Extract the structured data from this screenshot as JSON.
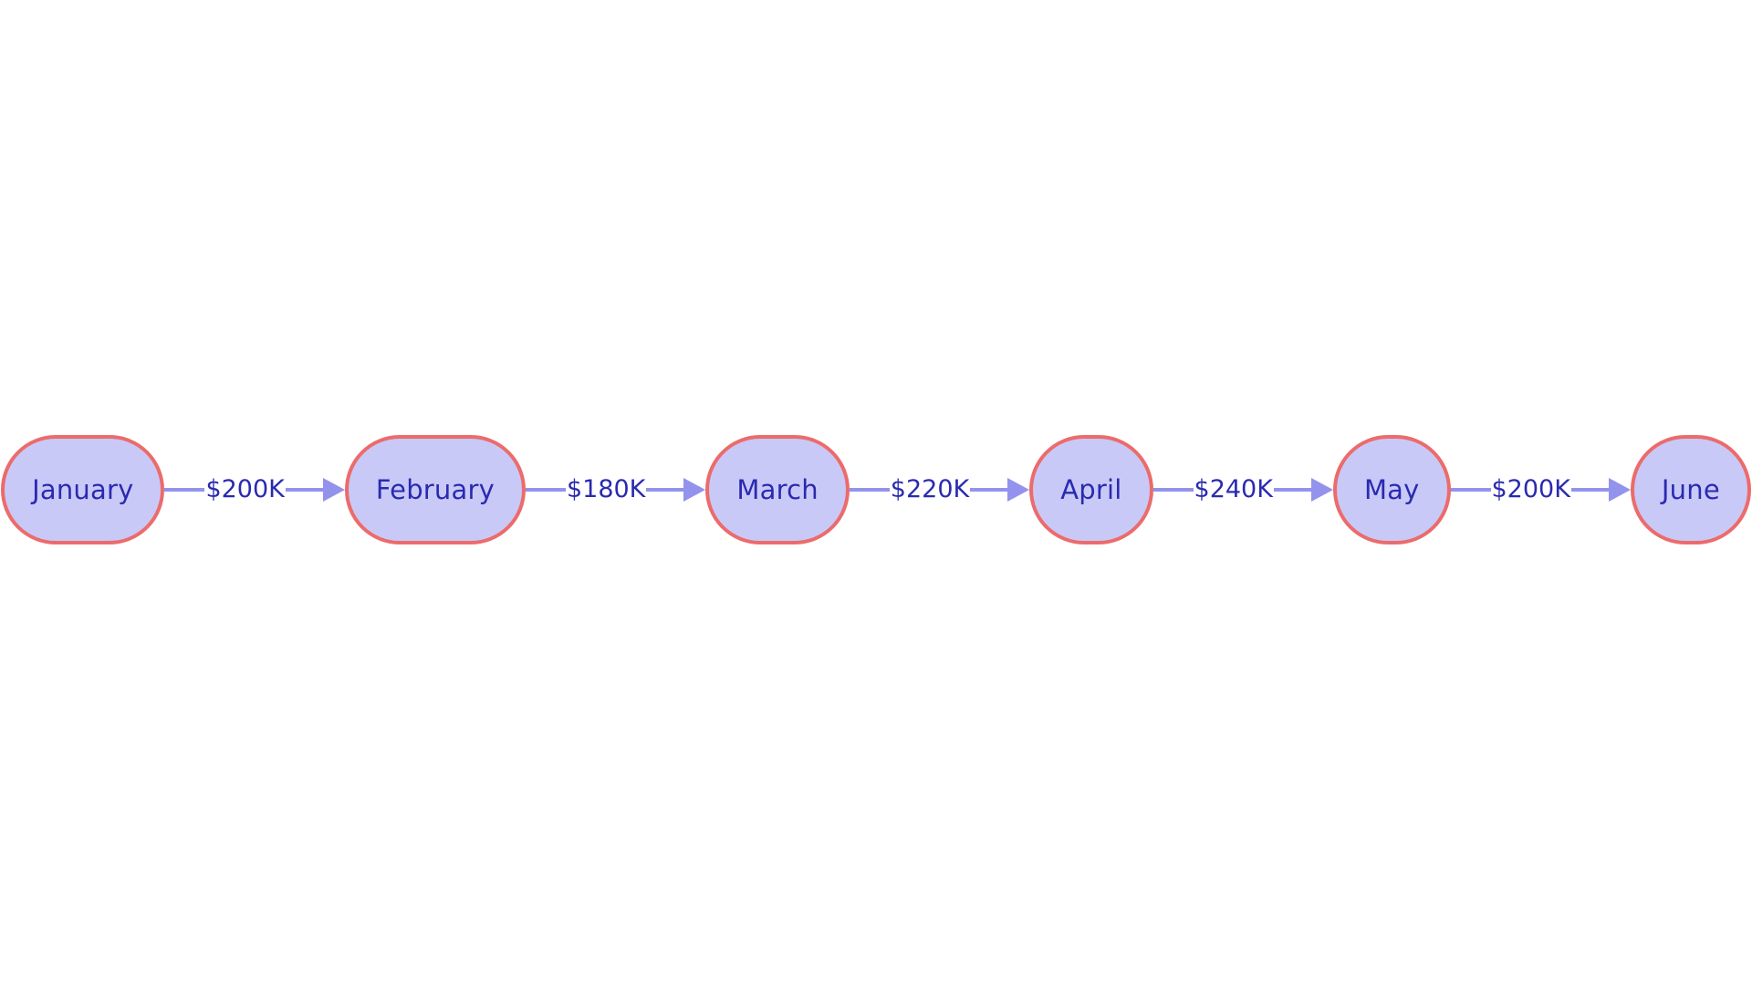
{
  "diagram": {
    "type": "flowchart-lr",
    "background": "#ffffff",
    "node_fill": "#c9c9f8",
    "node_stroke": "#ec6b6b",
    "node_text_color": "#2a2ab0",
    "edge_color": "#9393ed",
    "edge_label_color": "#2a2ab0",
    "nodes": [
      {
        "id": "january",
        "label": "January"
      },
      {
        "id": "february",
        "label": "February"
      },
      {
        "id": "march",
        "label": "March"
      },
      {
        "id": "april",
        "label": "April"
      },
      {
        "id": "may",
        "label": "May"
      },
      {
        "id": "june",
        "label": "June"
      }
    ],
    "edges": [
      {
        "from": "january",
        "to": "february",
        "label": "$200K"
      },
      {
        "from": "february",
        "to": "march",
        "label": "$180K"
      },
      {
        "from": "march",
        "to": "april",
        "label": "$220K"
      },
      {
        "from": "april",
        "to": "may",
        "label": "$240K"
      },
      {
        "from": "may",
        "to": "june",
        "label": "$200K"
      }
    ]
  },
  "chart_data": {
    "type": "diagram",
    "title": "",
    "categories": [
      "January",
      "February",
      "March",
      "April",
      "May",
      "June"
    ],
    "transitions": [
      {
        "from": "January",
        "to": "February",
        "value": 200000,
        "display": "$200K"
      },
      {
        "from": "February",
        "to": "March",
        "value": 180000,
        "display": "$180K"
      },
      {
        "from": "March",
        "to": "April",
        "value": 220000,
        "display": "$220K"
      },
      {
        "from": "April",
        "to": "May",
        "value": 240000,
        "display": "$240K"
      },
      {
        "from": "May",
        "to": "June",
        "value": 200000,
        "display": "$200K"
      }
    ]
  }
}
